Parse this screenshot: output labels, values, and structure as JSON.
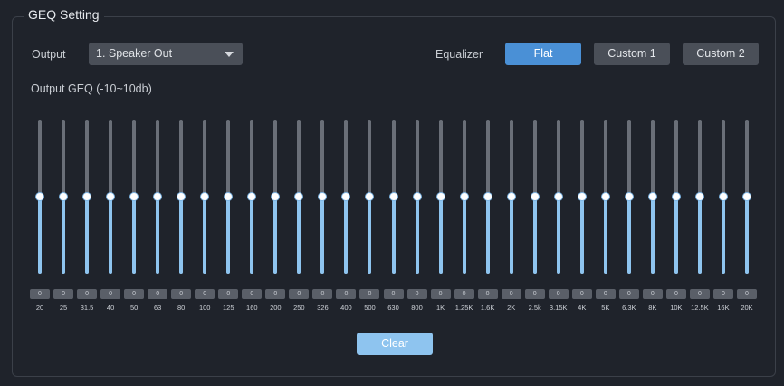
{
  "panel": {
    "title": "GEQ Setting"
  },
  "output": {
    "label": "Output",
    "selected": "1. Speaker Out"
  },
  "equalizer": {
    "label": "Equalizer",
    "presets": [
      "Flat",
      "Custom 1",
      "Custom 2"
    ],
    "active_preset": "Flat"
  },
  "geq": {
    "label": "Output GEQ (-10~10db)",
    "range_db": [
      -10,
      10
    ],
    "bands": [
      {
        "freq": "20",
        "value": "0"
      },
      {
        "freq": "25",
        "value": "0"
      },
      {
        "freq": "31.5",
        "value": "0"
      },
      {
        "freq": "40",
        "value": "0"
      },
      {
        "freq": "50",
        "value": "0"
      },
      {
        "freq": "63",
        "value": "0"
      },
      {
        "freq": "80",
        "value": "0"
      },
      {
        "freq": "100",
        "value": "0"
      },
      {
        "freq": "125",
        "value": "0"
      },
      {
        "freq": "160",
        "value": "0"
      },
      {
        "freq": "200",
        "value": "0"
      },
      {
        "freq": "250",
        "value": "0"
      },
      {
        "freq": "326",
        "value": "0"
      },
      {
        "freq": "400",
        "value": "0"
      },
      {
        "freq": "500",
        "value": "0"
      },
      {
        "freq": "630",
        "value": "0"
      },
      {
        "freq": "800",
        "value": "0"
      },
      {
        "freq": "1K",
        "value": "0"
      },
      {
        "freq": "1.25K",
        "value": "0"
      },
      {
        "freq": "1.6K",
        "value": "0"
      },
      {
        "freq": "2K",
        "value": "0"
      },
      {
        "freq": "2.5k",
        "value": "0"
      },
      {
        "freq": "3.15K",
        "value": "0"
      },
      {
        "freq": "4K",
        "value": "0"
      },
      {
        "freq": "5K",
        "value": "0"
      },
      {
        "freq": "6.3K",
        "value": "0"
      },
      {
        "freq": "8K",
        "value": "0"
      },
      {
        "freq": "10K",
        "value": "0"
      },
      {
        "freq": "12.5K",
        "value": "0"
      },
      {
        "freq": "16K",
        "value": "0"
      },
      {
        "freq": "20K",
        "value": "0"
      }
    ]
  },
  "clear_button": {
    "label": "Clear"
  },
  "colors": {
    "background": "#1f232b",
    "accent": "#4a90d6",
    "slider_fill": "#8ec4ef",
    "button_inactive": "#4a4f58"
  },
  "icons": {
    "dropdown": "caret-down-icon"
  }
}
